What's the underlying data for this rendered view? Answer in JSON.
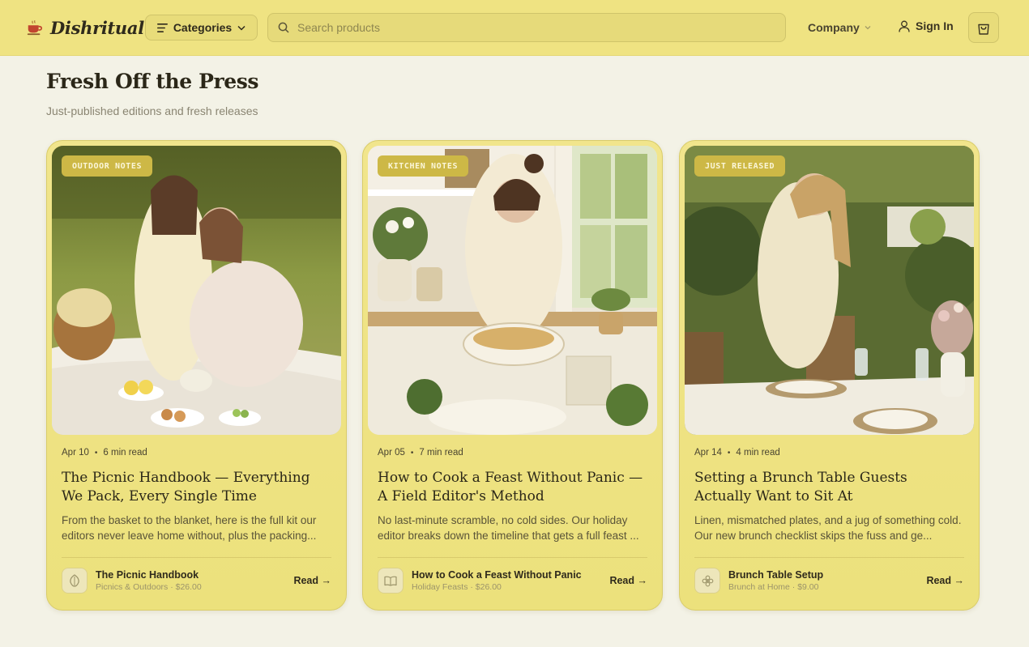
{
  "header": {
    "brand": "Dishritual",
    "categories_label": "Categories",
    "search_placeholder": "Search products",
    "company_label": "Company",
    "signin_label": "Sign In"
  },
  "section": {
    "title": "Fresh Off the Press",
    "subtitle": "Just-published editions and fresh releases"
  },
  "cards": [
    {
      "badge": "OUTDOOR NOTES",
      "date": "Apr 10",
      "read_time": "6 min read",
      "title": "The Picnic Handbook — Everything We Pack, Every Single Time",
      "excerpt": "From the basket to the blanket, here is the full kit our editors never leave home without, plus the packing...",
      "product_name": "The Picnic Handbook",
      "product_sub": "Picnics & Outdoors · $26.00",
      "product_icon": "leaf-icon",
      "read_label": "Read →"
    },
    {
      "badge": "KITCHEN NOTES",
      "date": "Apr 05",
      "read_time": "7 min read",
      "title": "How to Cook a Feast Without Panic — A Field Editor's Method",
      "excerpt": "No last-minute scramble, no cold sides. Our holiday editor breaks down the timeline that gets a full feast ...",
      "product_name": "How to Cook a Feast Without Panic",
      "product_sub": "Holiday Feasts · $26.00",
      "product_icon": "book-icon",
      "read_label": "Read →"
    },
    {
      "badge": "JUST RELEASED",
      "date": "Apr 14",
      "read_time": "4 min read",
      "title": "Setting a Brunch Table Guests Actually Want to Sit At",
      "excerpt": "Linen, mismatched plates, and a jug of something cold. Our new brunch checklist skips the fuss and ge...",
      "product_name": "Brunch Table Setup",
      "product_sub": "Brunch at Home · $9.00",
      "product_icon": "flower-icon",
      "read_label": "Read →"
    }
  ],
  "colors": {
    "header_bg": "#efe382",
    "page_bg": "#f3f2e6",
    "card_bg": "#efe382",
    "badge_bg": "#cdb846"
  }
}
